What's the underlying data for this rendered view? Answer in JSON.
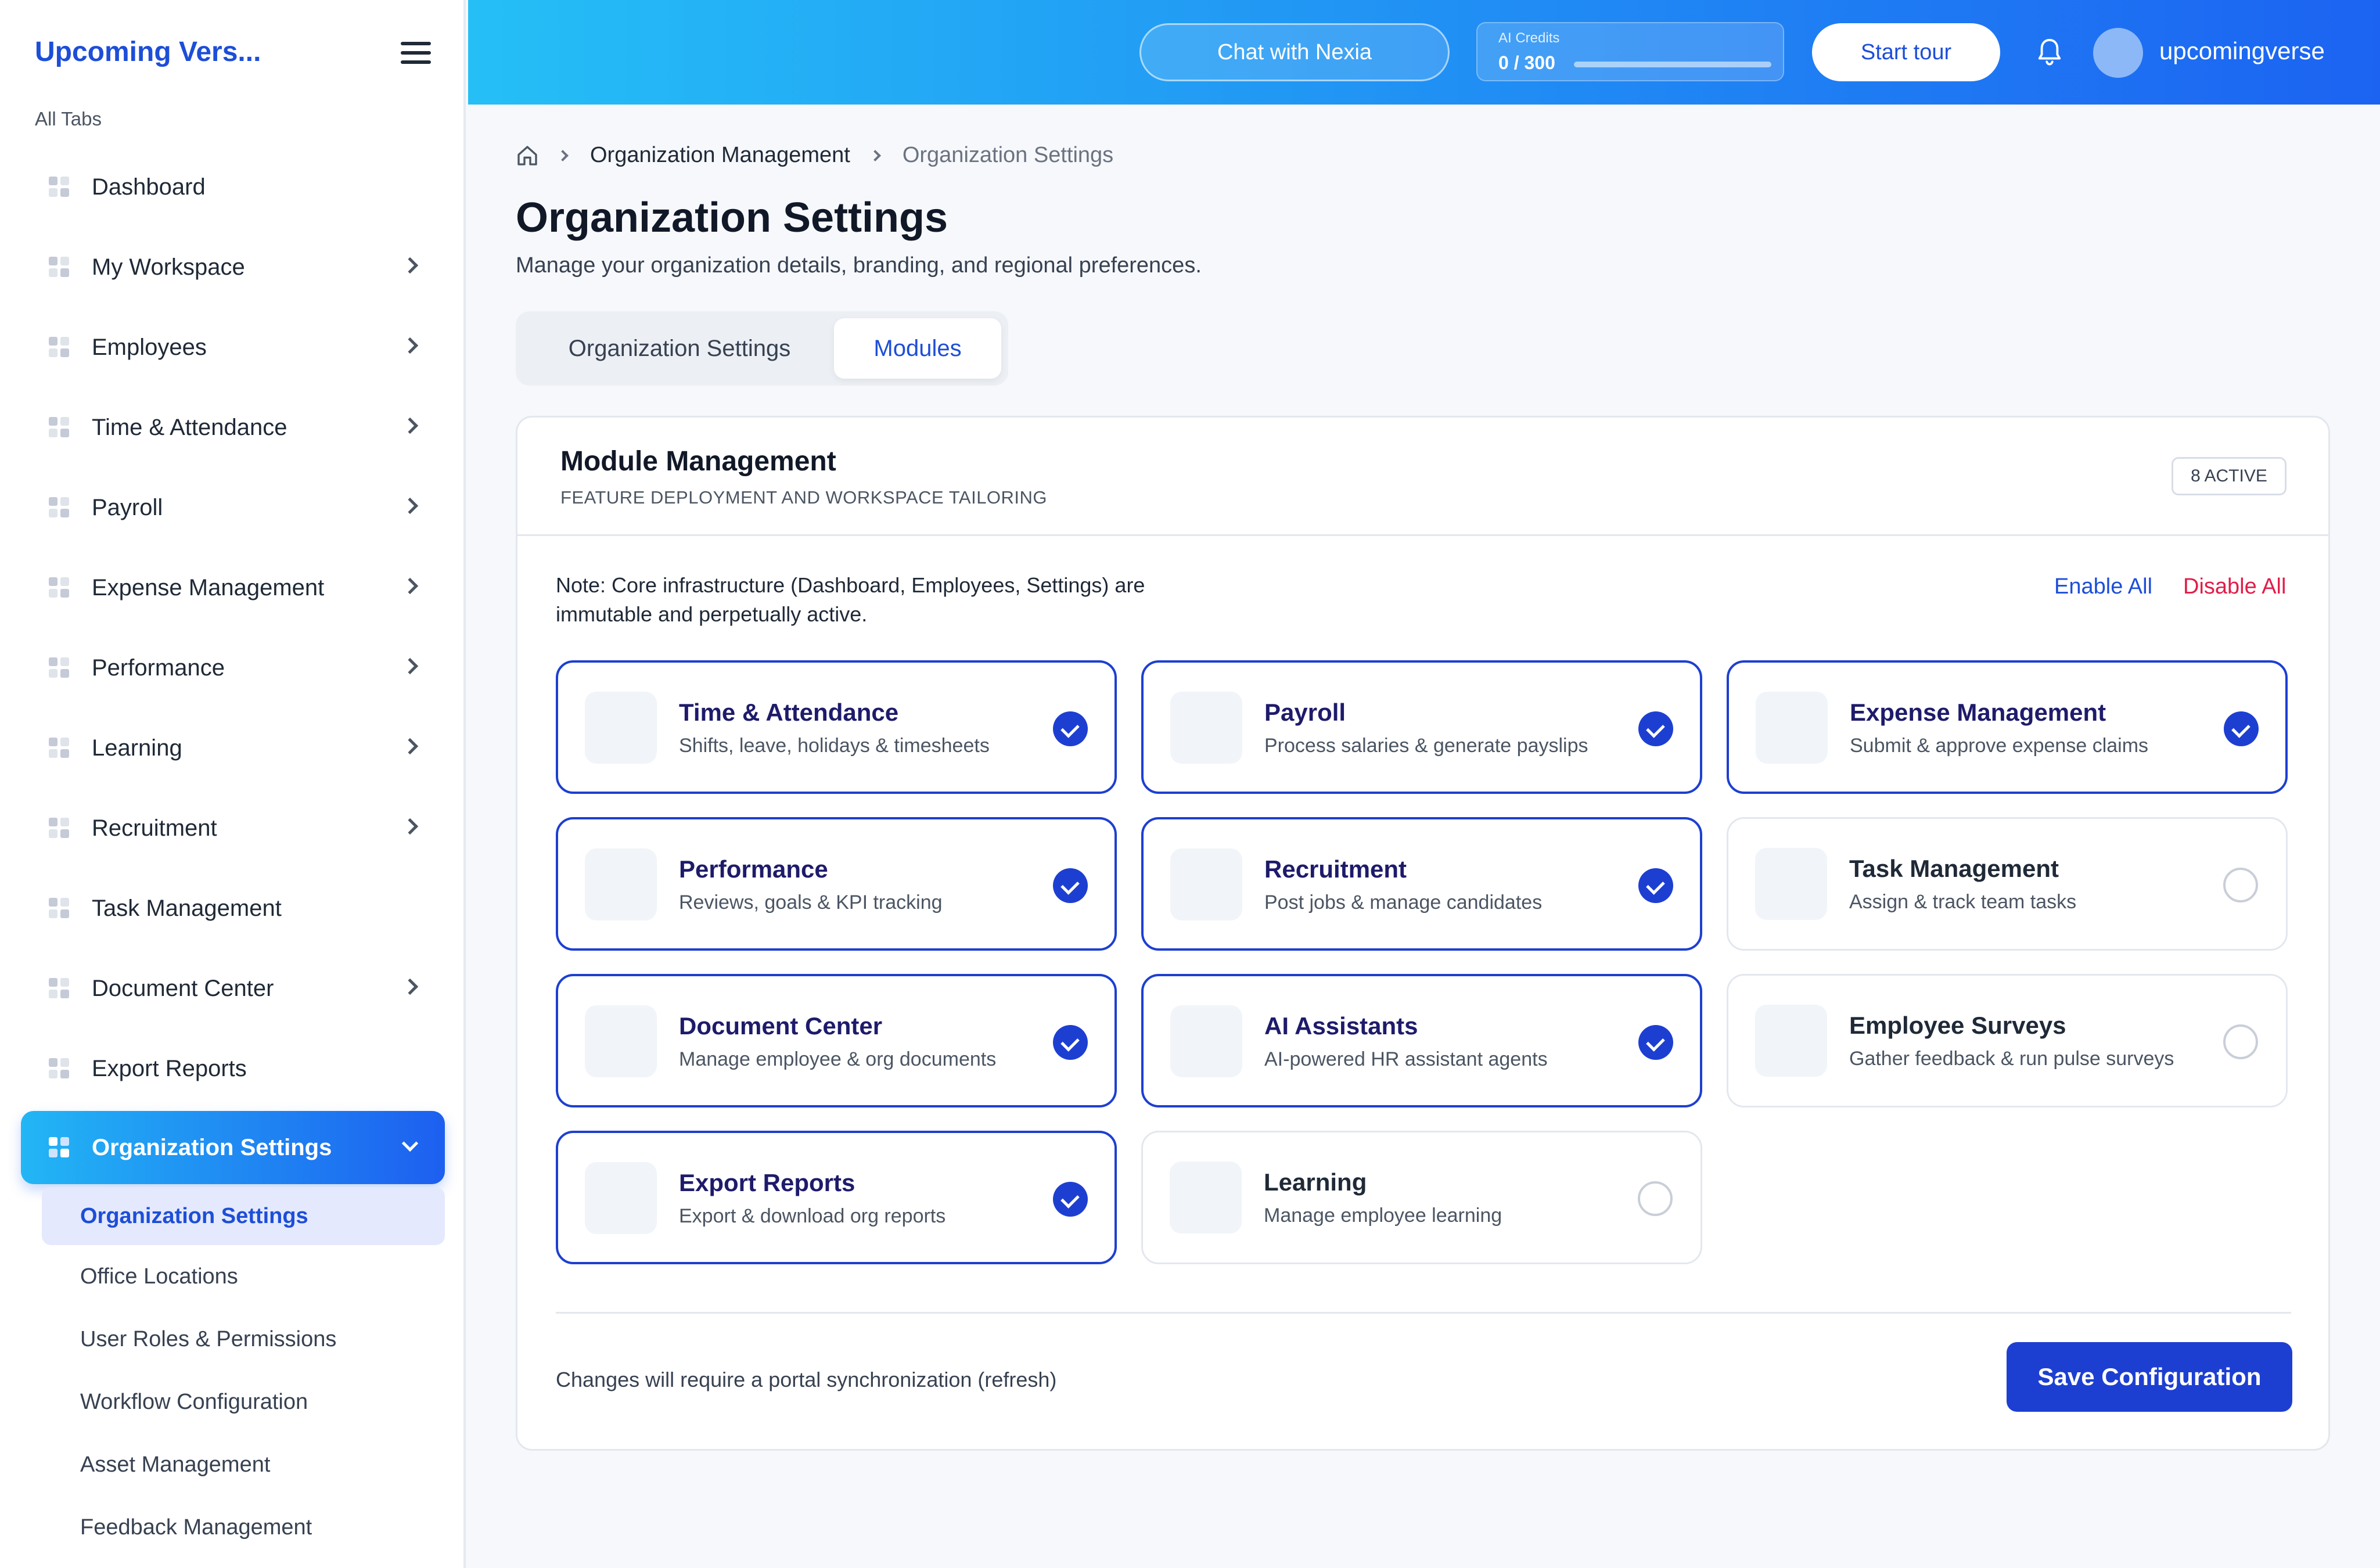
{
  "sidebar": {
    "brand": "Upcoming Vers...",
    "section_label": "All Tabs",
    "items": [
      {
        "label": "Dashboard"
      },
      {
        "label": "My Workspace"
      },
      {
        "label": "Employees"
      },
      {
        "label": "Time & Attendance"
      },
      {
        "label": "Payroll"
      },
      {
        "label": "Expense Management"
      },
      {
        "label": "Performance"
      },
      {
        "label": "Learning"
      },
      {
        "label": "Recruitment"
      },
      {
        "label": "Task Management"
      },
      {
        "label": "Document Center"
      },
      {
        "label": "Export Reports"
      },
      {
        "label": "Organization Settings"
      }
    ],
    "sub_items": [
      {
        "label": "Organization Settings"
      },
      {
        "label": "Office Locations"
      },
      {
        "label": "User Roles & Permissions"
      },
      {
        "label": "Workflow Configuration"
      },
      {
        "label": "Asset Management"
      },
      {
        "label": "Feedback Management"
      }
    ]
  },
  "header": {
    "chat_label": "Chat with Nexia",
    "credits_label": "AI Credits",
    "credits_value": "0 / 300",
    "credits_used_fraction": 0,
    "tour_label": "Start tour",
    "username": "upcomingverse"
  },
  "breadcrumb": {
    "parent": "Organization Management",
    "current": "Organization Settings"
  },
  "page": {
    "title": "Organization Settings",
    "subtitle": "Manage your organization details, branding, and regional preferences."
  },
  "tabs": [
    "Organization Settings",
    "Modules"
  ],
  "module_card": {
    "title": "Module Management",
    "subtitle": "FEATURE DEPLOYMENT AND WORKSPACE TAILORING",
    "badge": "8 ACTIVE",
    "note": "Note: Core infrastructure (Dashboard, Employees, Settings) are immutable and perpetually active.",
    "enable_all": "Enable All",
    "disable_all": "Disable All",
    "modules": [
      {
        "name": "Time & Attendance",
        "desc": "Shifts, leave, holidays & timesheets",
        "enabled": true
      },
      {
        "name": "Payroll",
        "desc": "Process salaries & generate payslips",
        "enabled": true
      },
      {
        "name": "Expense Management",
        "desc": "Submit & approve expense claims",
        "enabled": true
      },
      {
        "name": "Performance",
        "desc": "Reviews, goals & KPI tracking",
        "enabled": true
      },
      {
        "name": "Recruitment",
        "desc": "Post jobs & manage candidates",
        "enabled": true
      },
      {
        "name": "Task Management",
        "desc": "Assign & track team tasks",
        "enabled": false
      },
      {
        "name": "Document Center",
        "desc": "Manage employee & org documents",
        "enabled": true
      },
      {
        "name": "AI Assistants",
        "desc": "AI-powered HR assistant agents",
        "enabled": true
      },
      {
        "name": "Employee Surveys",
        "desc": "Gather feedback & run pulse surveys",
        "enabled": false
      },
      {
        "name": "Export Reports",
        "desc": "Export & download org reports",
        "enabled": true
      },
      {
        "name": "Learning",
        "desc": "Manage employee learning",
        "enabled": false
      }
    ],
    "footer_note": "Changes will require a portal synchronization (refresh)",
    "save_label": "Save Configuration"
  },
  "colors": {
    "accent": "#1d3fd1",
    "header_gradient_start": "#25bff6",
    "header_gradient_end": "#1c63f2",
    "danger": "#e11d48"
  }
}
